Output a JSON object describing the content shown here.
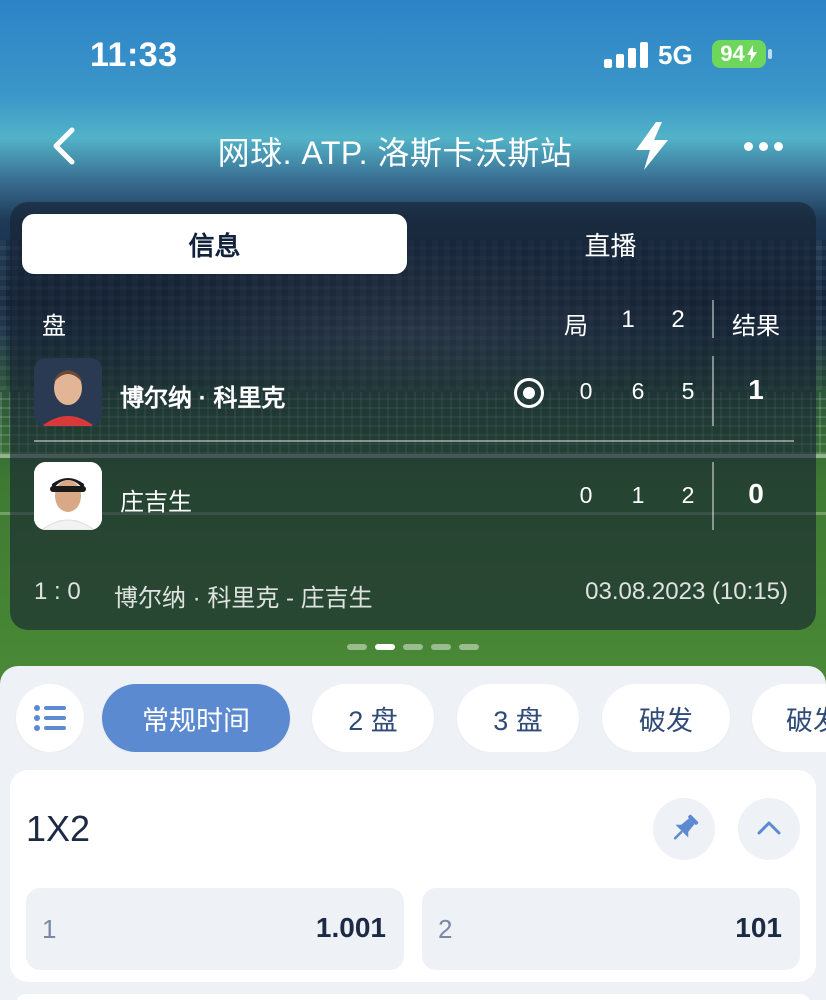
{
  "status_bar": {
    "time": "11:33",
    "network": "5G",
    "battery": "94"
  },
  "nav": {
    "title": "网球. ATP. 洛斯卡沃斯站",
    "icons": [
      "chevron-left-icon",
      "lightning-icon",
      "more-dots-icon"
    ]
  },
  "score_card": {
    "tabs": [
      {
        "label": "信息",
        "active": true
      },
      {
        "label": "直播",
        "active": false
      }
    ],
    "header": {
      "set_label": "盘",
      "games_label": "局",
      "set1": "1",
      "set2": "2",
      "result_label": "结果"
    },
    "players": [
      {
        "name": "博尔纳 · 科里克",
        "games": "0",
        "set1": "6",
        "set2": "5",
        "result": "1",
        "serving": true
      },
      {
        "name": "庄吉生",
        "games": "0",
        "set1": "1",
        "set2": "2",
        "result": "0",
        "serving": false
      }
    ],
    "footer": {
      "score": "1 : 0",
      "match": "博尔纳 · 科里克 - 庄吉生",
      "date": "03.08.2023 (10:15)"
    },
    "pager": {
      "count": 5,
      "active_index": 1
    }
  },
  "filters": {
    "chips": [
      {
        "label": "常规时间",
        "active": true
      },
      {
        "label": "2 盘",
        "active": false
      },
      {
        "label": "3 盘",
        "active": false
      },
      {
        "label": "破发",
        "active": false
      },
      {
        "label": "破发",
        "active": false
      }
    ]
  },
  "market": {
    "title": "1X2",
    "odds": [
      {
        "label": "1",
        "value": "1.001"
      },
      {
        "label": "2",
        "value": "101"
      }
    ]
  },
  "colors": {
    "accent": "#5b8ad0",
    "battery": "#6fd65c",
    "text_dark": "#1d2a44",
    "chip_text": "#2f4b77"
  }
}
